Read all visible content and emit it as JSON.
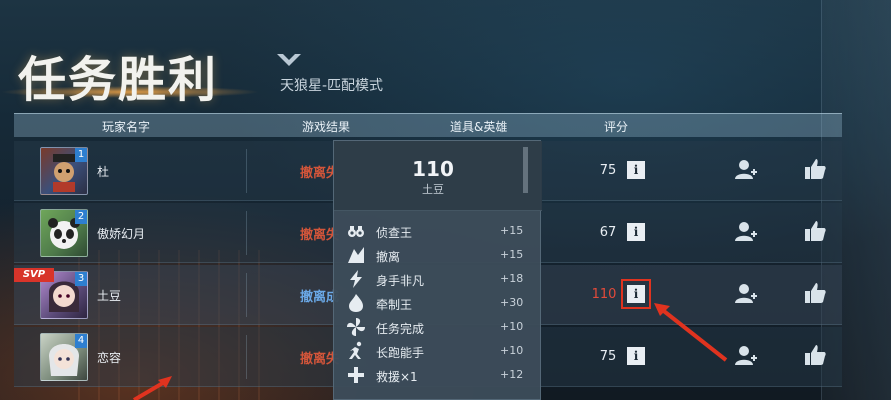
{
  "header": {
    "title": "任务胜利",
    "subtitle": "天狼星-匹配模式"
  },
  "table": {
    "columns": [
      "玩家名字",
      "游戏结果",
      "道具&英雄",
      "评分"
    ],
    "rows": [
      {
        "rank": "1",
        "name": "杜",
        "result": "撤离失",
        "score": "75",
        "avatar_color": "#3b4f7a",
        "avatar_icon": "mech-warrior-avatar"
      },
      {
        "rank": "2",
        "name": "傲娇幻月",
        "result": "撤离失",
        "score": "67",
        "avatar_color": "#4e7a4a",
        "avatar_icon": "panda-avatar"
      },
      {
        "rank": "3",
        "name": "土豆",
        "result": "撤离成",
        "score": "110",
        "avatar_color": "#5a4a78",
        "avatar_icon": "anime-girl-avatar"
      },
      {
        "rank": "4",
        "name": "恋容",
        "result": "撤离失",
        "score": "75",
        "avatar_color": "#7a8a7a",
        "avatar_icon": "silver-hair-avatar"
      }
    ],
    "svp_label": "SVP"
  },
  "popup": {
    "score": "110",
    "player": "土豆",
    "bonuses": [
      {
        "icon": "binoculars-icon",
        "label": "侦查王",
        "value": "+15"
      },
      {
        "icon": "evacuation-icon",
        "label": "撤离",
        "value": "+15"
      },
      {
        "icon": "lightning-icon",
        "label": "身手非凡",
        "value": "+18"
      },
      {
        "icon": "flame-icon",
        "label": "牵制王",
        "value": "+30"
      },
      {
        "icon": "fan-icon",
        "label": "任务完成",
        "value": "+10"
      },
      {
        "icon": "runner-icon",
        "label": "长跑能手",
        "value": "+10"
      },
      {
        "icon": "cross-icon",
        "label": "救援×1",
        "value": "+12"
      }
    ]
  },
  "colors": {
    "fail_result": "#d2553a",
    "success_result": "#6aa8e6",
    "highlight": "#e0331f",
    "svp_badge": "#d8342a"
  }
}
